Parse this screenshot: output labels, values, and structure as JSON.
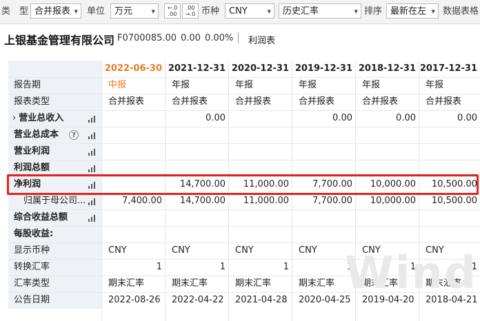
{
  "toolbar": {
    "type_label": "类　型",
    "type_value": "合并报表",
    "unit_label": "单位",
    "unit_value": "万元",
    "dec_inc": ".0 .00",
    "dec_dec": ".00 .0",
    "currency_label": "币种",
    "currency_value": "CNY",
    "rate_value": "历史汇率",
    "sort_label": "排序",
    "sort_value": "最新在左",
    "data_label": "数据表格"
  },
  "title": {
    "company": "上银基金管理有限公司",
    "code": "F0700085.00",
    "value": "0.00",
    "change": "0.00%",
    "report": "利润表"
  },
  "columns": [
    "2022-06-30",
    "2021-12-31",
    "2020-12-31",
    "2019-12-31",
    "2018-12-31",
    "2017-12-31"
  ],
  "rows": [
    {
      "label": "报告期",
      "bold": false,
      "values": [
        "中报",
        "年报",
        "年报",
        "年报",
        "年报",
        "年报"
      ],
      "align": "left"
    },
    {
      "label": "报表类型",
      "bold": false,
      "values": [
        "合并报表",
        "合并报表",
        "合并报表",
        "合并报表",
        "合并报表",
        "合并报表"
      ],
      "align": "left"
    },
    {
      "label": "营业总收入",
      "bold": true,
      "expand": "›",
      "chart": true,
      "values": [
        "",
        "0.00",
        "",
        "0.00",
        "0.00",
        "0.00"
      ],
      "align": "right"
    },
    {
      "label": "营业总成本",
      "bold": true,
      "help": "?",
      "chart": true,
      "values": [
        "",
        "",
        "",
        "",
        "",
        ""
      ],
      "align": "right"
    },
    {
      "label": "营业利润",
      "bold": true,
      "chart": true,
      "values": [
        "",
        "",
        "",
        "",
        "",
        ""
      ],
      "align": "right"
    },
    {
      "label": "利润总额",
      "bold": true,
      "chart": true,
      "values": [
        "",
        "",
        "",
        "",
        "",
        ""
      ],
      "align": "right"
    },
    {
      "label": "净利润",
      "bold": true,
      "chart": true,
      "values": [
        "",
        "14,700.00",
        "11,000.00",
        "7,700.00",
        "10,000.00",
        "10,500.00"
      ],
      "align": "right"
    },
    {
      "label": "归属于母公司...",
      "bold": false,
      "indent": true,
      "chart": true,
      "values": [
        "7,400.00",
        "14,700.00",
        "11,000.00",
        "7,700.00",
        "10,000.00",
        "10,500.00"
      ],
      "align": "right"
    },
    {
      "label": "综合收益总额",
      "bold": true,
      "chart": true,
      "values": [
        "",
        "",
        "",
        "",
        "",
        ""
      ],
      "align": "right"
    },
    {
      "label": "每股收益:",
      "bold": true,
      "values": [
        "",
        "",
        "",
        "",
        "",
        ""
      ],
      "align": "right"
    },
    {
      "label": "显示币种",
      "bold": false,
      "values": [
        "CNY",
        "CNY",
        "CNY",
        "CNY",
        "CNY",
        "CNY"
      ],
      "align": "left"
    },
    {
      "label": "转换汇率",
      "bold": false,
      "values": [
        "1",
        "1",
        "1",
        "1",
        "1",
        "1"
      ],
      "align": "right"
    },
    {
      "label": "汇率类型",
      "bold": false,
      "values": [
        "期末汇率",
        "期末汇率",
        "期末汇率",
        "期末汇率",
        "期末汇率",
        "期末汇率"
      ],
      "align": "left"
    },
    {
      "label": "公告日期",
      "bold": false,
      "values": [
        "2022-08-26",
        "2022-04-22",
        "2021-04-28",
        "2020-04-25",
        "2019-04-20",
        "2018-04-21"
      ],
      "align": "left"
    }
  ],
  "watermark": "Wind"
}
